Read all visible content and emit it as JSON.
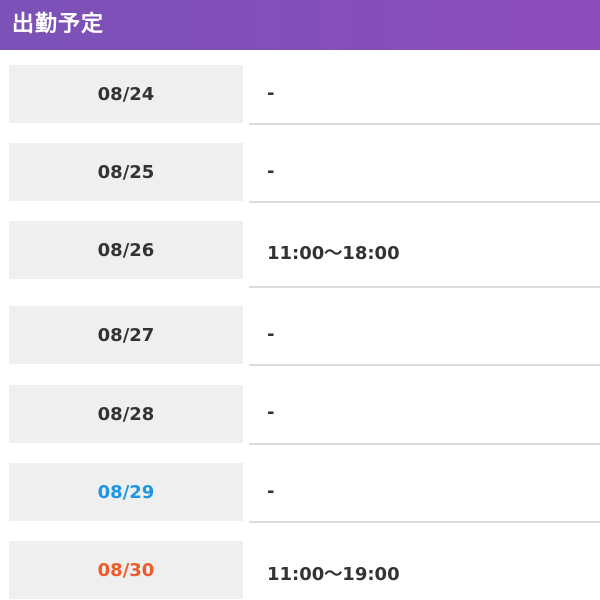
{
  "header": {
    "title": "出勤予定",
    "background_start": "#7b52b8",
    "background_end": "#8e4cbb"
  },
  "schedule": [
    {
      "date": "08/24",
      "time": "-",
      "date_color": "#333333"
    },
    {
      "date": "08/25",
      "time": "-",
      "date_color": "#333333"
    },
    {
      "date": "08/26",
      "time": "11:00〜18:00",
      "date_color": "#333333"
    },
    {
      "date": "08/27",
      "time": "-",
      "date_color": "#333333"
    },
    {
      "date": "08/28",
      "time": "-",
      "date_color": "#333333"
    },
    {
      "date": "08/29",
      "time": "-",
      "date_color": "#1e96e6"
    },
    {
      "date": "08/30",
      "time": "11:00〜19:00",
      "date_color": "#ee5a2a"
    }
  ]
}
